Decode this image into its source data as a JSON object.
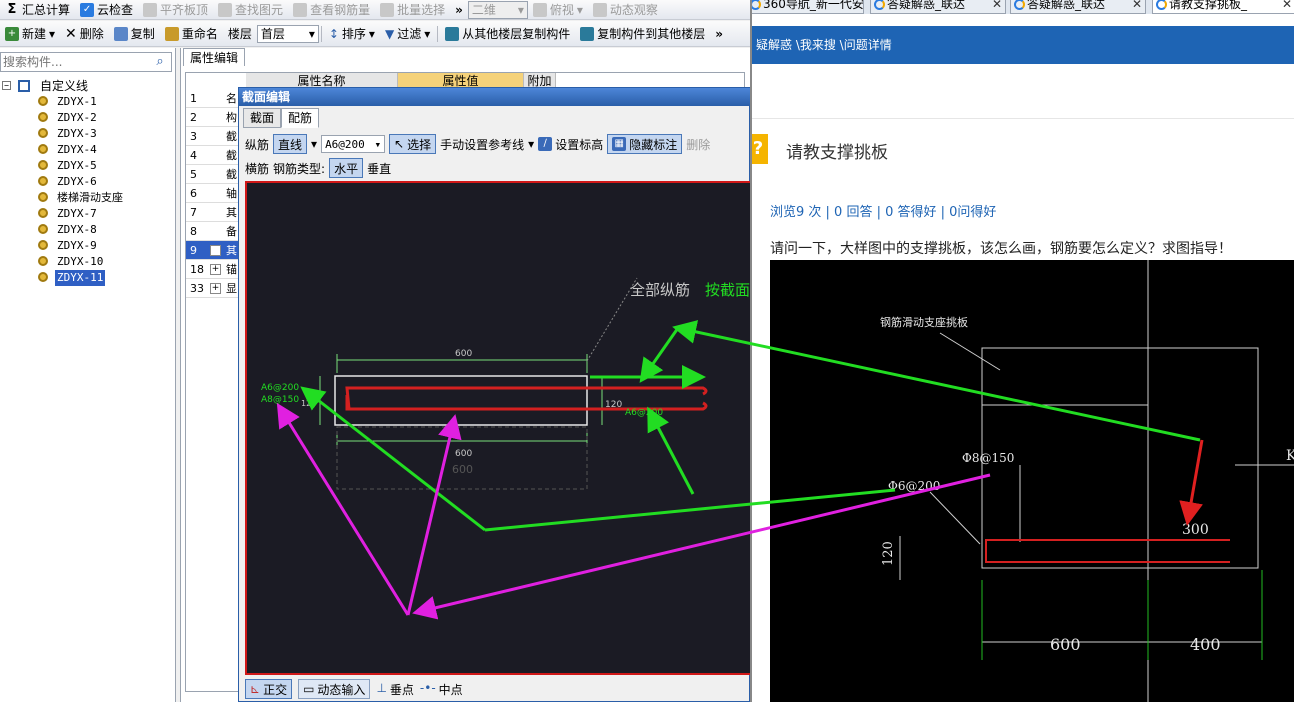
{
  "toolbar1": {
    "sum_calc": "汇总计算",
    "cloud_check": "云检查",
    "flat_slab": "平齐板顶",
    "find_element": "查找图元",
    "view_rebar_qty": "查看钢筋量",
    "batch_select": "批量选择",
    "view_2d": "二维",
    "top_view": "俯视",
    "dynamic_view": "动态观察",
    "more": "»"
  },
  "toolbar2": {
    "new": "新建",
    "delete": "删除",
    "copy": "复制",
    "rename": "重命名",
    "floor_label": "楼层",
    "floor_value": "首层",
    "sort": "排序",
    "filter": "过滤",
    "copy_from_floor": "从其他楼层复制构件",
    "copy_to_floor": "复制构件到其他楼层",
    "more": "»"
  },
  "search": {
    "placeholder": "搜索构件..."
  },
  "tree": {
    "root": "自定义线",
    "items": [
      "ZDYX-1",
      "ZDYX-2",
      "ZDYX-3",
      "ZDYX-4",
      "ZDYX-5",
      "ZDYX-6",
      "楼梯滑动支座",
      "ZDYX-7",
      "ZDYX-8",
      "ZDYX-9",
      "ZDYX-10",
      "ZDYX-11"
    ],
    "selected": "ZDYX-11"
  },
  "property_panel": {
    "tab": "属性编辑",
    "headers": [
      "属性名称",
      "属性值",
      "附加"
    ],
    "rows": [
      {
        "num": "1",
        "name": "名"
      },
      {
        "num": "2",
        "name": "构"
      },
      {
        "num": "3",
        "name": "截"
      },
      {
        "num": "4",
        "name": "截"
      },
      {
        "num": "5",
        "name": "截"
      },
      {
        "num": "6",
        "name": "轴"
      },
      {
        "num": "7",
        "name": "其"
      },
      {
        "num": "8",
        "name": "备"
      },
      {
        "num": "9",
        "name": "其"
      },
      {
        "num": "18",
        "name": "锚"
      },
      {
        "num": "33",
        "name": "显"
      }
    ]
  },
  "section_dialog": {
    "title": "截面编辑",
    "tabs": [
      "截面",
      "配筋"
    ],
    "active_tab": "配筋",
    "longitudinal_label": "纵筋",
    "line_type": "直线",
    "rebar_spec": "A6@200",
    "select": "选择",
    "manual_ref_line": "手动设置参考线",
    "set_elevation": "设置标高",
    "hide_annotation": "隐藏标注",
    "delete": "删除",
    "transverse_label": "横筋",
    "rebar_type_label": "钢筋类型:",
    "horizontal": "水平",
    "vertical": "垂直",
    "canvas": {
      "all_long_label": "全部纵筋",
      "by_section_label": "按截面",
      "dim_top": "600",
      "dim_bottom": "600",
      "dim_ghost": "600",
      "dim_height": "120",
      "left_label_1": "A6@200",
      "left_label_2": "A8@150",
      "right_label": "A6@200",
      "small_label": "120"
    },
    "status": {
      "ortho": "正交",
      "dynamic_input": "动态输入",
      "perpendicular": "垂点",
      "midpoint": "中点"
    }
  },
  "browser": {
    "tabs": [
      "360导航_新一代安",
      "答疑解惑_联达",
      "答疑解惑_联达",
      "请教支撑挑板_"
    ],
    "active_tab_index": 3,
    "breadcrumb": "疑解惑 \\我来搜 \\问题详情",
    "question_icon": "?",
    "question_title": "请教支撑挑板",
    "stats": "浏览9 次 | 0 回答 | 0 答得好 | 0问得好",
    "question_body": "请问一下，大样图中的支撑挑板，该怎么画，钢筋要怎么定义？求图指导！",
    "drawing": {
      "title": "钢筋滑动支座挑板",
      "rebar_1": "Φ8@150",
      "rebar_2": "Φ6@200",
      "dim_300": "300",
      "dim_120": "120",
      "dim_600": "600",
      "dim_400": "400",
      "partial_label": "K"
    }
  },
  "colors": {
    "accent_blue": "#1e64b4",
    "selection_blue": "#2f5fc4",
    "rebar_red": "#d42020",
    "annotation_green": "#22dd22",
    "annotation_magenta": "#e020e0",
    "canvas_bg": "#1b1b24"
  }
}
